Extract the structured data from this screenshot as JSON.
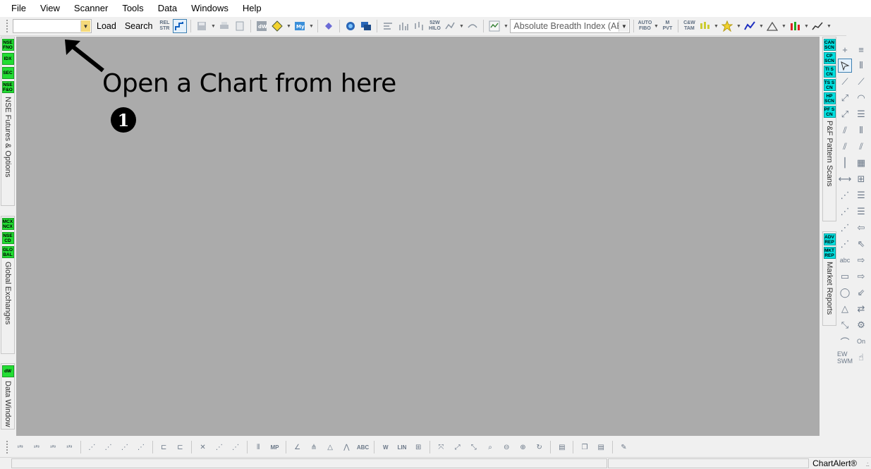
{
  "menu": [
    "File",
    "View",
    "Scanner",
    "Tools",
    "Data",
    "Windows",
    "Help"
  ],
  "toolbar": {
    "symbol_value": "",
    "load_label": "Load",
    "search_label": "Search",
    "relstr_label": "REL STR",
    "indicator_selected": "Absolute Breadth Index (AB",
    "auto_fibo": "AUTO FIBO",
    "m_pvt": "M PVT",
    "cw_tam": "C&W TAM",
    "w52_hilo": "52W HILO"
  },
  "hint": {
    "text": "Open a Chart from here",
    "number": "1"
  },
  "left_panels": {
    "futures": {
      "badges": [
        "NSE FNO",
        "IDX",
        "SEC",
        "NSE F&O"
      ],
      "label": "NSE Futures & Options"
    },
    "global": {
      "badges": [
        "MCX NCX",
        "NSE CD",
        "GLO BAL"
      ],
      "label": "Global Exchanges"
    },
    "data": {
      "badges": [
        "dW"
      ],
      "label": "Data Window"
    }
  },
  "right_panels": {
    "pattern": {
      "badges": [
        "CAN SCN",
        "CP SCN",
        "TI SCN",
        "TS SCN",
        "HP SCN",
        "PF SCN"
      ],
      "label": "P&F Pattern Scans"
    },
    "reports": {
      "badges": [
        "ADV REP",
        "MKT REP"
      ],
      "label": "Market Reports"
    }
  },
  "drawing_tools": {
    "abc_label": "abc",
    "ew_label": "EW SWM",
    "on_label": "On"
  },
  "bottom_toolbar": {
    "lin_label": "LIN",
    "mp_label": "MP",
    "w_label": "W",
    "abc_label": "ABC"
  },
  "status": {
    "brand": "ChartAlert®"
  }
}
